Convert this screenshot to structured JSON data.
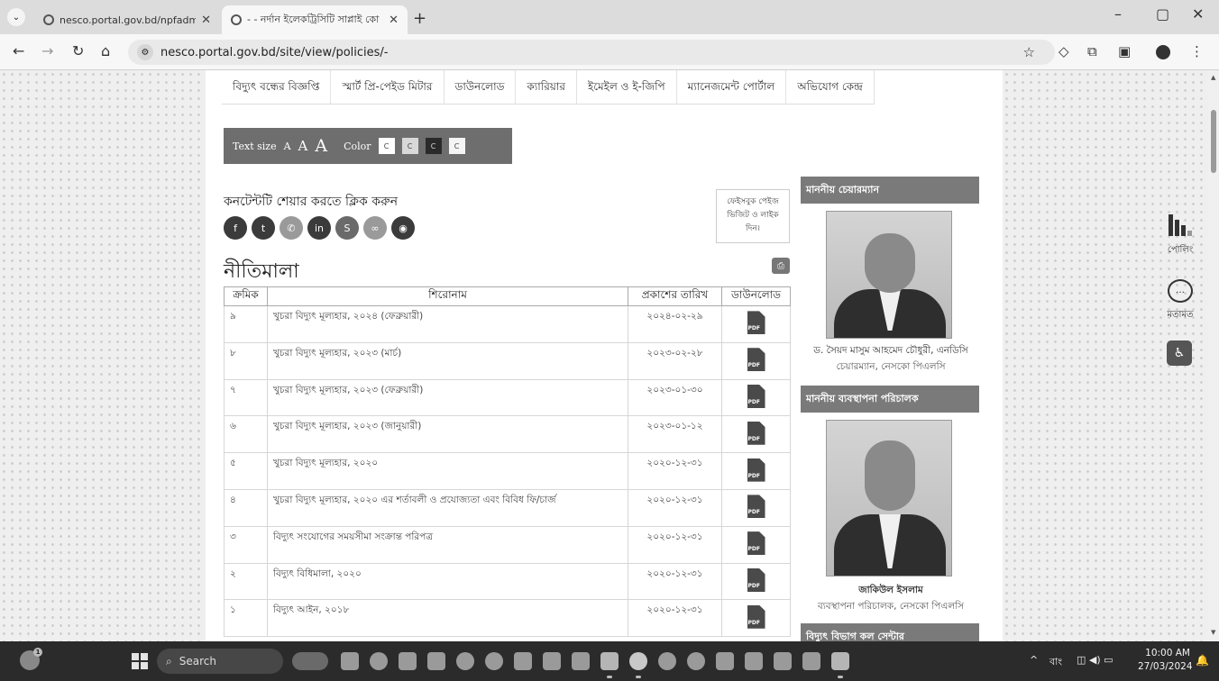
{
  "browser": {
    "tabs": [
      {
        "title": "nesco.portal.gov.bd/npfadmin/"
      },
      {
        "title": "- - নর্দান ইলেকট্রিসিটি সাপ্লাই কো"
      }
    ],
    "new_tab": "+",
    "url": "nesco.portal.gov.bd/site/view/policies/-",
    "window_controls": {
      "minimize": "–",
      "restore": "▢",
      "close": "✕"
    }
  },
  "main_nav": [
    "বিদ্যুৎ বন্ধের বিজ্ঞপ্তি",
    "স্মার্ট প্রি-পেইড মিটার",
    "ডাউনলোড",
    "ক্যারিয়ার",
    "ইমেইল ও ই-জিপি",
    "ম্যানেজমেন্ট পোর্টাল",
    "অভিযোগ কেন্দ্র"
  ],
  "accessibility": {
    "text_size_label": "Text size",
    "sizes": [
      "A",
      "A",
      "A"
    ],
    "color_label": "Color",
    "color_options": [
      {
        "label": "C",
        "bg": "#ffffff"
      },
      {
        "label": "C",
        "bg": "#d8d8d8"
      },
      {
        "label": "C",
        "bg": "#2a2a2a"
      },
      {
        "label": "C",
        "bg": "#f4f4f4"
      }
    ]
  },
  "share": {
    "title": "কনটেন্টটি শেয়ার করতে ক্লিক করুন",
    "icons": [
      "facebook-icon",
      "twitter-icon",
      "whatsapp-icon",
      "linkedin-icon",
      "skype-icon",
      "link-icon",
      "messenger-icon"
    ],
    "facebook_box": "ফেইসবুক পেইজ ভিজিট ও লাইক দিন।"
  },
  "page_title": "নীতিমালা",
  "table": {
    "headers": [
      "ক্রমিক",
      "শিরোনাম",
      "প্রকাশের তারিখ",
      "ডাউনলোড"
    ],
    "rows": [
      {
        "serial": "৯",
        "title": "খুচরা বিদ্যুৎ মূল্যহার, ২০২৪ (ফেব্রুয়ারী)",
        "date": "২০২৪-০২-২৯"
      },
      {
        "serial": "৮",
        "title": "খুচরা বিদ্যুৎ মূল্যহার, ২০২৩ (মার্চ)",
        "date": "২০২৩-০২-২৮"
      },
      {
        "serial": "৭",
        "title": "খুচরা বিদ্যুৎ মূল্যহার, ২০২৩ (ফেব্রুয়ারী)",
        "date": "২০২৩-০১-৩০"
      },
      {
        "serial": "৬",
        "title": "খুচরা বিদ্যুৎ মূল্যহার, ২০২৩ (জানুয়ারী)",
        "date": "২০২৩-০১-১২"
      },
      {
        "serial": "৫",
        "title": "খুচরা বিদ্যুৎ মূল্যহার, ২০২০",
        "date": "২০২০-১২-৩১"
      },
      {
        "serial": "৪",
        "title": "খুচরা বিদ্যুৎ মূল্যহার, ২০২০ এর শর্তাবলী ও প্রযোজ্যতা এবং বিবিধ ফি/চার্জ",
        "date": "২০২০-১২-৩১"
      },
      {
        "serial": "৩",
        "title": "বিদ্যুৎ সংযোগের সময়সীমা সংক্রান্ত পরিপত্র",
        "date": "২০২০-১২-৩১"
      },
      {
        "serial": "২",
        "title": "বিদ্যুৎ বিধিমালা, ২০২০",
        "date": "২০২০-১২-৩১"
      },
      {
        "serial": "১",
        "title": "বিদ্যুৎ আইন, ২০১৮",
        "date": "২০২০-১২-৩১"
      }
    ],
    "pdf_label": "PDF"
  },
  "sidebar": {
    "chairman_heading": "মাননীয় চেয়ারম্যান",
    "chairman_name": "ড. সৈয়দ মাসুম আহমেদ চৌধুরী, এনডিসি",
    "chairman_role": "চেয়ারম্যান, নেসকো পিএলসি",
    "md_heading": "মাননীয় ব্যবস্থাপনা পরিচালক",
    "md_name": "জাকিউল ইসলাম",
    "md_role": "ব্যবস্থাপনা পরিচালক, নেসকো পিএলসি",
    "call_center_heading": "বিদ্যুৎ বিভাগ কল সেন্টার"
  },
  "floating": {
    "poll_label": "পোলিং",
    "feedback_label": "মতামত"
  },
  "taskbar": {
    "search_placeholder": "Search",
    "weather_badge": "1",
    "language": "বাং",
    "time": "10:00 AM",
    "date": "27/03/2024"
  }
}
